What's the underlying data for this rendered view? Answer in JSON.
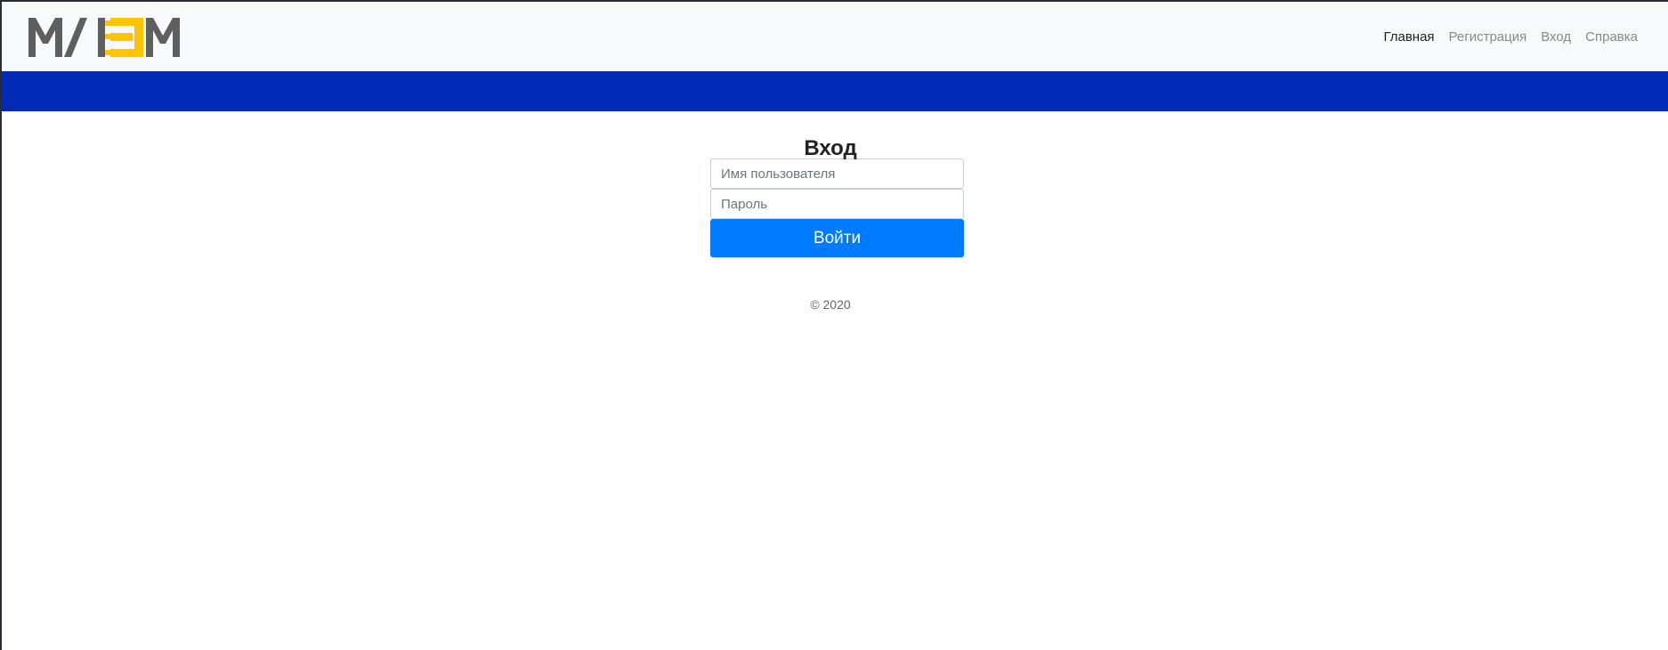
{
  "brand": {
    "logo_text": "МИЭМ",
    "colors": {
      "gray": "#5f5f5f",
      "accent": "#ffc400"
    }
  },
  "nav": {
    "items": [
      {
        "label": "Главная",
        "active": true
      },
      {
        "label": "Регистрация",
        "active": false
      },
      {
        "label": "Вход",
        "active": false
      },
      {
        "label": "Справка",
        "active": false
      }
    ]
  },
  "band": {
    "color": "#0029b6"
  },
  "login": {
    "title": "Вход",
    "username_placeholder": "Имя пользователя",
    "password_placeholder": "Пароль",
    "submit_label": "Войти",
    "submit_color": "#007bff"
  },
  "footer": {
    "text": "© 2020"
  }
}
